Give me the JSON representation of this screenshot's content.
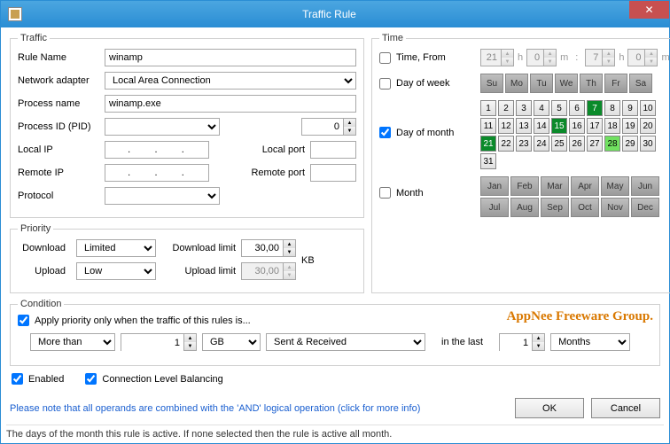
{
  "window": {
    "title": "Traffic Rule"
  },
  "traffic": {
    "legend": "Traffic",
    "ruleName": {
      "label": "Rule Name",
      "value": "winamp"
    },
    "network": {
      "label": "Network adapter",
      "value": "Local Area Connection"
    },
    "process": {
      "label": "Process name",
      "value": "winamp.exe"
    },
    "pid": {
      "label": "Process ID (PID)",
      "value": "",
      "spin": "0"
    },
    "localIp": {
      "label": "Local IP",
      "value": ".     .     ."
    },
    "localPort": {
      "label": "Local port",
      "value": ""
    },
    "remoteIp": {
      "label": "Remote IP",
      "value": ".     .     ."
    },
    "remotePort": {
      "label": "Remote port",
      "value": ""
    },
    "protocol": {
      "label": "Protocol",
      "value": ""
    }
  },
  "priority": {
    "legend": "Priority",
    "download": {
      "label": "Download",
      "value": "Limited"
    },
    "upload": {
      "label": "Upload",
      "value": "Low"
    },
    "dlLimit": {
      "label": "Download limit",
      "value": "30,00"
    },
    "ulLimit": {
      "label": "Upload limit",
      "value": "30,00"
    },
    "unit": "KB"
  },
  "time": {
    "legend": "Time",
    "timeFrom": {
      "label": "Time, From",
      "checked": false,
      "h1": "21",
      "m1": "0",
      "h2": "7",
      "m2": "0"
    },
    "dayOfWeek": {
      "label": "Day of week",
      "checked": false,
      "days": [
        "Su",
        "Mo",
        "Tu",
        "We",
        "Th",
        "Fr",
        "Sa"
      ]
    },
    "dayOfMonth": {
      "label": "Day of month",
      "checked": true,
      "dark": [
        7,
        15,
        21
      ],
      "light": [
        28
      ]
    },
    "month": {
      "label": "Month",
      "checked": false,
      "months": [
        "Jan",
        "Feb",
        "Mar",
        "Apr",
        "May",
        "Jun",
        "Jul",
        "Aug",
        "Sep",
        "Oct",
        "Nov",
        "Dec"
      ]
    }
  },
  "condition": {
    "legend": "Condition",
    "applyLabel": "Apply priority only when the traffic of this rules is...",
    "op": "More than",
    "amount": "1",
    "unit": "GB",
    "direction": "Sent & Received",
    "inLast": "in the last",
    "period": "1",
    "periodUnit": "Months"
  },
  "enabled": {
    "label": "Enabled",
    "checked": true
  },
  "clb": {
    "label": "Connection Level Balancing",
    "checked": true
  },
  "info": "Please note that all operands are combined with the 'AND' logical operation (click for more info)",
  "buttons": {
    "ok": "OK",
    "cancel": "Cancel"
  },
  "status": "The days of the month this rule is active. If none selected then the rule is active all month.",
  "watermark": "AppNee Freeware Group.",
  "units": {
    "h": "h",
    "m": "m",
    "colon": ":"
  }
}
